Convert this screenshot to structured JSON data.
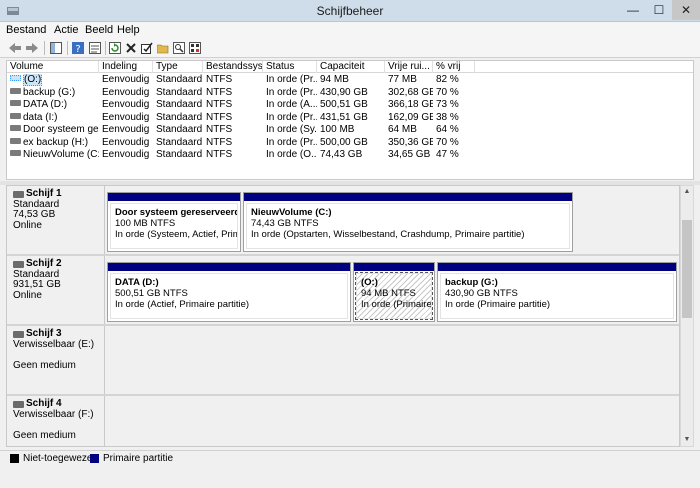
{
  "window": {
    "title": "Schijfbeheer",
    "minimize": "—",
    "maximize": "☐",
    "close": "✕"
  },
  "menu": [
    {
      "label": "Bestand"
    },
    {
      "label": "Actie"
    },
    {
      "label": "Beeld"
    },
    {
      "label": "Help"
    }
  ],
  "toolbar": {
    "icons": [
      "back-icon",
      "forward-icon",
      "show-hide-tree-icon",
      "help-icon",
      "properties-icon",
      "refresh-icon",
      "delete-icon",
      "check-icon",
      "open-icon",
      "explore-icon",
      "settings-icon"
    ]
  },
  "volumes": {
    "columns": [
      "Volume",
      "Indeling",
      "Type",
      "Bestandssys...",
      "Status",
      "Capaciteit",
      "Vrije rui...",
      "% vrij"
    ],
    "rows": [
      [
        "(O:)",
        "Eenvoudig",
        "Standaard",
        "NTFS",
        "In orde (Pr...",
        "94 MB",
        "77 MB",
        "82 %"
      ],
      [
        "backup (G:)",
        "Eenvoudig",
        "Standaard",
        "NTFS",
        "In orde (Pr...",
        "430,90 GB",
        "302,68 GB",
        "70 %"
      ],
      [
        "DATA (D:)",
        "Eenvoudig",
        "Standaard",
        "NTFS",
        "In orde (A...",
        "500,51 GB",
        "366,18 GB",
        "73 %"
      ],
      [
        "data (I:)",
        "Eenvoudig",
        "Standaard",
        "NTFS",
        "In orde (Pr...",
        "431,51 GB",
        "162,09 GB",
        "38 %"
      ],
      [
        "Door systeem gere...",
        "Eenvoudig",
        "Standaard",
        "NTFS",
        "In orde (Sy...",
        "100 MB",
        "64 MB",
        "64 %"
      ],
      [
        "ex backup (H:)",
        "Eenvoudig",
        "Standaard",
        "NTFS",
        "In orde (Pr...",
        "500,00 GB",
        "350,36 GB",
        "70 %"
      ],
      [
        "NieuwVolume (C:)",
        "Eenvoudig",
        "Standaard",
        "NTFS",
        "In orde (O...",
        "74,43 GB",
        "34,65 GB",
        "47 %"
      ]
    ],
    "selected_index": 0
  },
  "disks": [
    {
      "name": "Schijf 1",
      "line2": "Standaard",
      "line3": "74,53 GB",
      "line4": "Online",
      "partitions": [
        {
          "name": "Door systeem gereserveerd",
          "size": "100 MB NTFS",
          "status": "In orde (Systeem, Actief, Primaire"
        },
        {
          "name": "NieuwVolume  (C:)",
          "size": "74,43 GB NTFS",
          "status": "In orde (Opstarten, Wisselbestand, Crashdump, Primaire partitie)"
        }
      ]
    },
    {
      "name": "Schijf 2",
      "line2": "Standaard",
      "line3": "931,51 GB",
      "line4": "Online",
      "partitions": [
        {
          "name": "DATA  (D:)",
          "size": "500,51 GB NTFS",
          "status": "In orde (Actief, Primaire partitie)"
        },
        {
          "name": "(O:)",
          "size": "94 MB NTFS",
          "status": "In orde (Primaire pa"
        },
        {
          "name": "backup  (G:)",
          "size": "430,90 GB NTFS",
          "status": "In orde (Primaire partitie)"
        }
      ]
    },
    {
      "name": "Schijf 3",
      "line2": "Verwisselbaar (E:)",
      "line3": "",
      "line4": "Geen medium",
      "partitions": []
    },
    {
      "name": "Schijf 4",
      "line2": "Verwisselbaar (F:)",
      "line3": "",
      "line4": "Geen medium",
      "partitions": []
    }
  ],
  "legend": [
    {
      "label": "Niet-toegewezen",
      "color": "#000000"
    },
    {
      "label": "Primaire partitie",
      "color": "#000080"
    }
  ],
  "colors": {
    "primary_partition": "#000080",
    "selection": "#cce4f7"
  }
}
